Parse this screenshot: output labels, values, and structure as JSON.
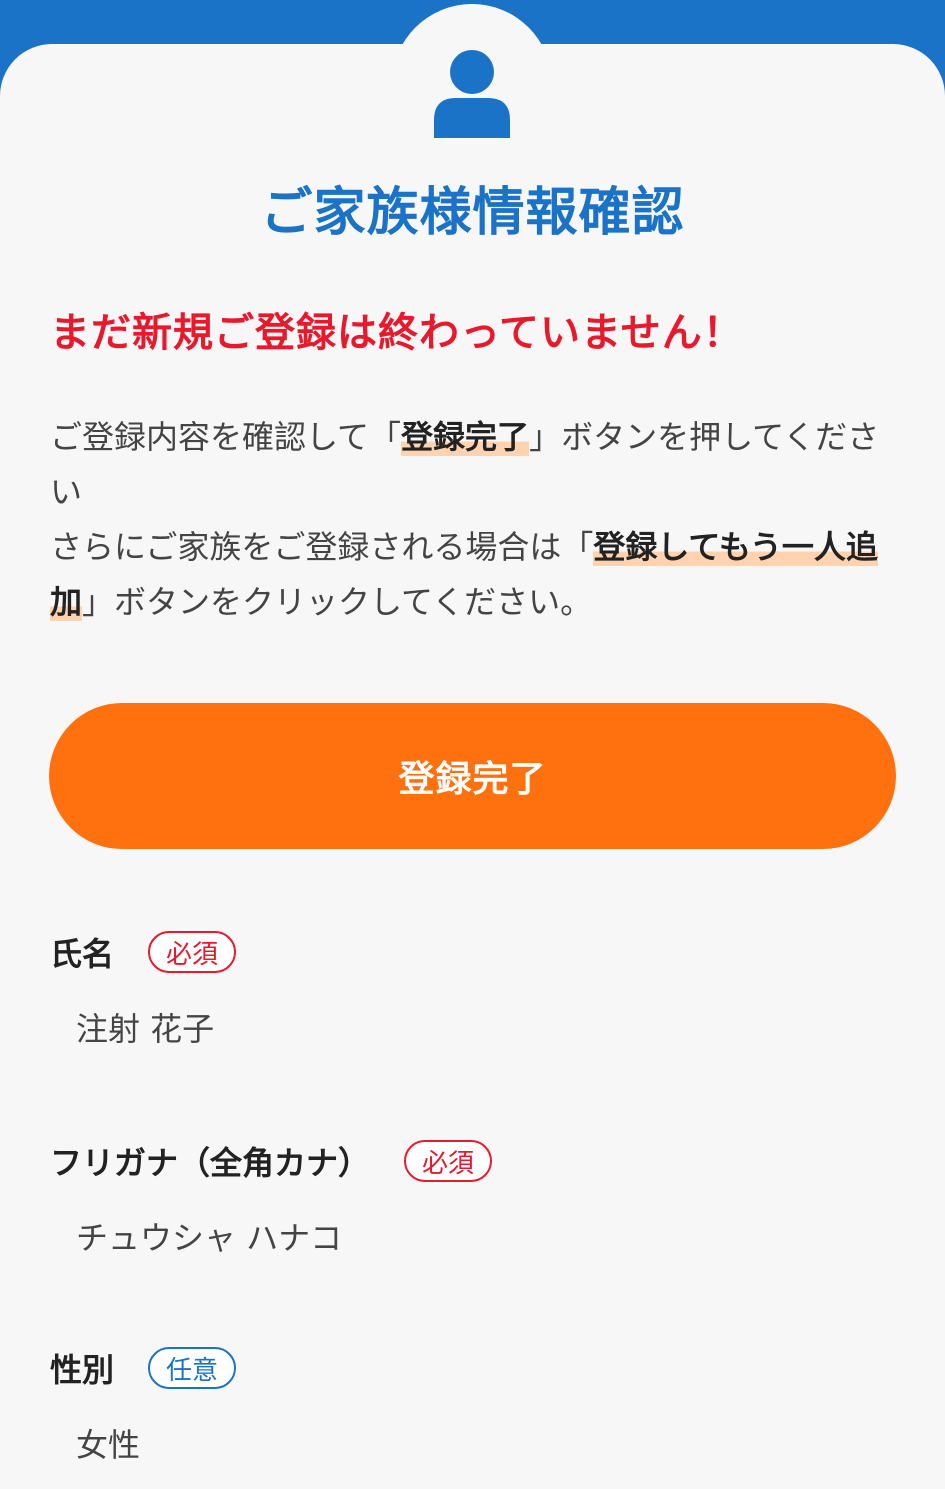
{
  "colors": {
    "brand_blue": "#1a73c7",
    "warning_red": "#e8192c",
    "button_orange": "#ff700f",
    "highlight": "#ffd3b0"
  },
  "header": {
    "icon": "user-icon",
    "title": "ご家族様情報確認"
  },
  "warning": "まだ新規ご登録は終わっていません！",
  "instructions": {
    "line1_pre": "ご登録内容を確認して「",
    "line1_highlight": "登録完了",
    "line1_post": "」ボタンを押してください",
    "line2_pre": "さらにご家族をご登録される場合は「",
    "line2_highlight": "登録してもう一人追加",
    "line2_post": "」ボタンをクリックしてください。"
  },
  "complete_button": "登録完了",
  "fields": [
    {
      "label": "氏名",
      "badge": "必須",
      "value": "注射 花子"
    },
    {
      "label": "フリガナ（全角カナ）",
      "badge": "必須",
      "value": "チュウシャ ハナコ"
    },
    {
      "label": "性別",
      "badge": "任意",
      "value": "女性"
    }
  ]
}
